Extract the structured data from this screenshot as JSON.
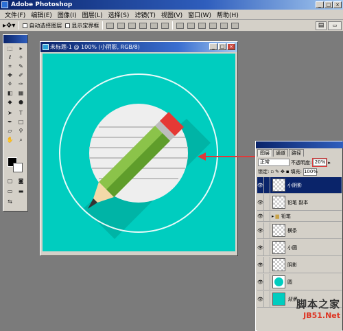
{
  "app": {
    "title": "Adobe Photoshop"
  },
  "menu": [
    "文件(F)",
    "编辑(E)",
    "图像(I)",
    "图层(L)",
    "选择(S)",
    "滤镜(T)",
    "视图(V)",
    "窗口(W)",
    "帮助(H)"
  ],
  "options": {
    "auto_select": "自动选择图层",
    "show_bounds": "显示定界框"
  },
  "document": {
    "title": "未标题-1 @ 100% (小阴影, RGB/8)"
  },
  "layers_panel": {
    "tabs": [
      "图层",
      "通道",
      "路径"
    ],
    "blend_mode": "正常",
    "opacity_label": "不透明度:",
    "opacity_value": "20%",
    "lock_label": "锁定:",
    "fill_label": "填充:",
    "fill_value": "100%",
    "layers": [
      {
        "name": "小阴影",
        "selected": true
      },
      {
        "name": "铅笔 副本",
        "selected": false
      },
      {
        "name": "铅笔",
        "selected": false,
        "folder": true
      },
      {
        "name": "横条",
        "selected": false
      },
      {
        "name": "小圆",
        "selected": false
      },
      {
        "name": "阴影",
        "selected": false
      },
      {
        "name": "圆",
        "selected": false
      },
      {
        "name": "背景",
        "selected": false
      }
    ]
  },
  "watermark": {
    "line1": "脚本之家",
    "line2": "JB51.Net"
  },
  "colors": {
    "canvas": "#00cdbf",
    "foreground": "#000000",
    "background": "#ffffff",
    "arrow": "#e03a3a"
  }
}
